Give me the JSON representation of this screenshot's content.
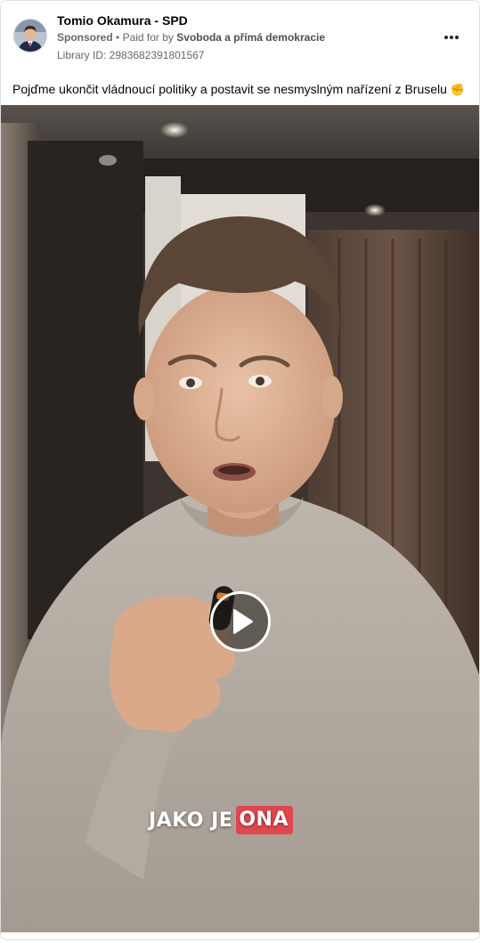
{
  "post": {
    "page_name": "Tomio Okamura - SPD",
    "sponsored_label": "Sponsored",
    "separator": "•",
    "paid_for_prefix": "Paid for by",
    "payer": "Svoboda a přímá demokracie",
    "library_id": "Library ID: 2983682391801567",
    "text": "Pojďme ukončit vládnoucí politiky a postavit se nesmyslným nařízení z Bruselu",
    "text_emoji": "✊"
  },
  "video": {
    "caption_plain": "JAKO JE",
    "caption_highlight": "ONA",
    "caption_highlight_color": "#e0484e",
    "play_icon": "play-icon"
  },
  "icons": {
    "more": "more-options-icon",
    "avatar": "page-avatar"
  }
}
